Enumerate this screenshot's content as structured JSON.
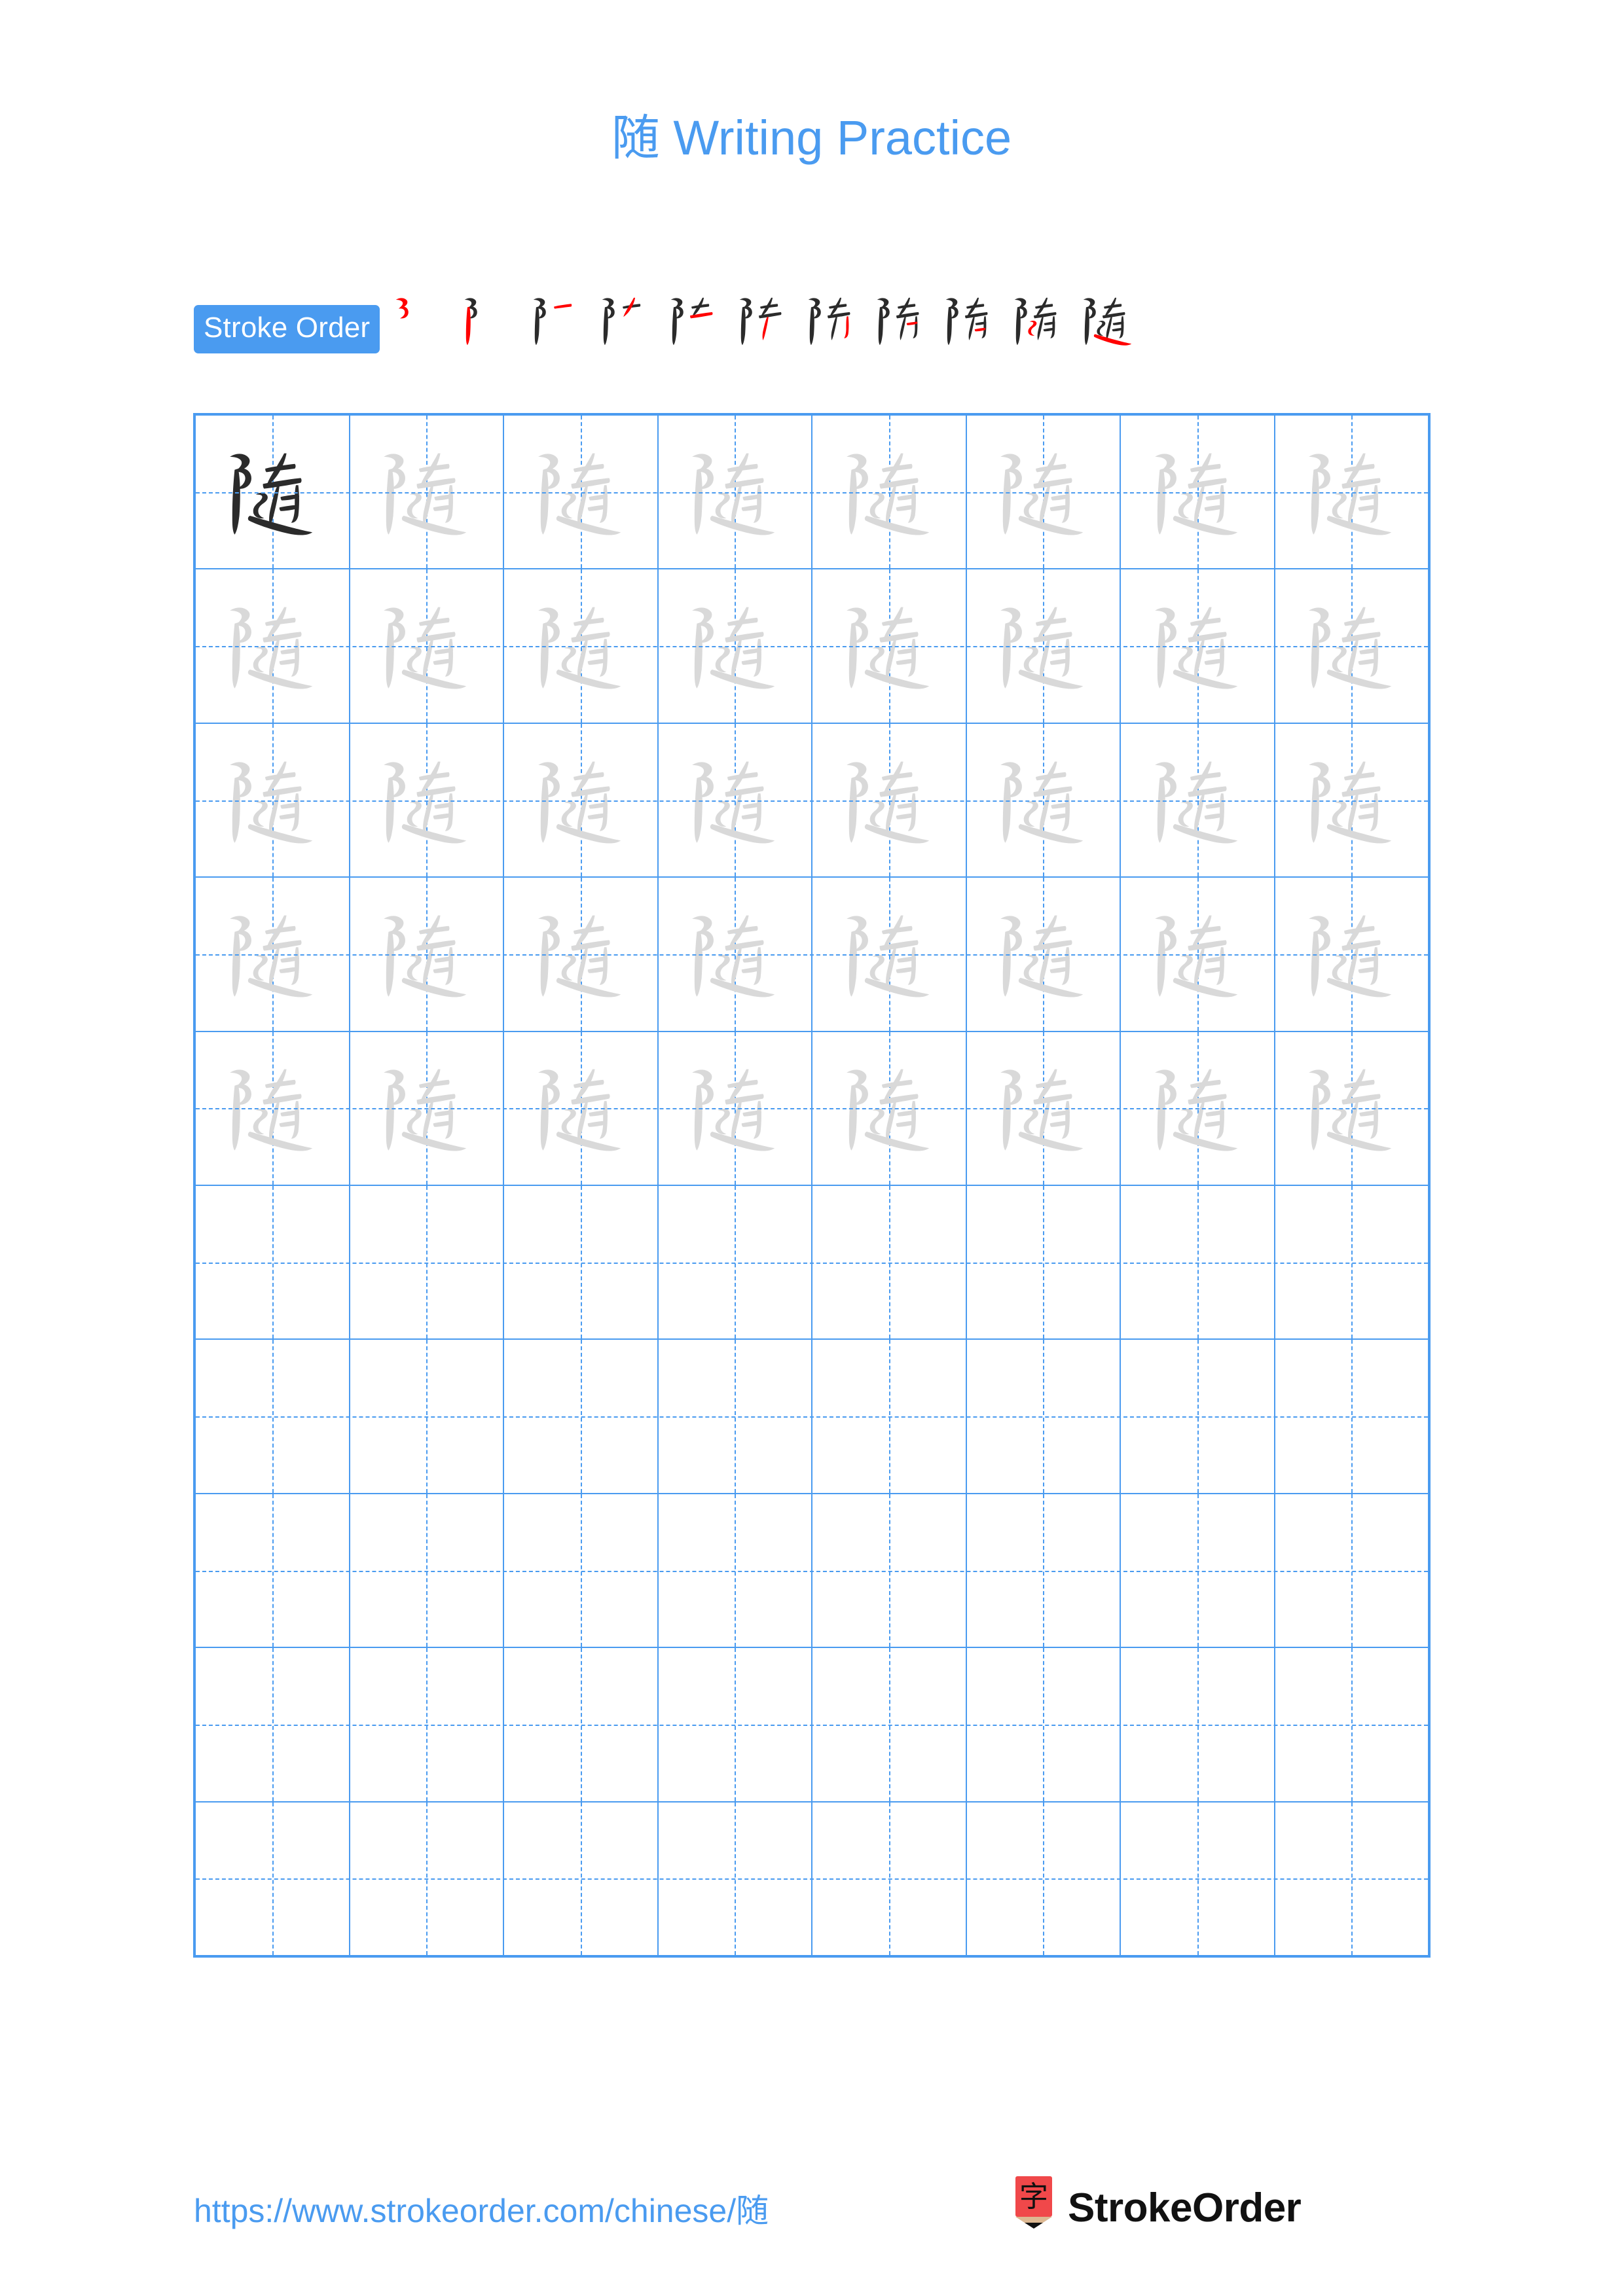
{
  "page": {
    "title_character": "随",
    "title_text": "随 Writing Practice",
    "accent_color": "#4a9bf0",
    "ink_color": "#2b2b2b",
    "trace_color": "#d9d9d9",
    "highlight_stroke_color": "#ff0000"
  },
  "stroke_order": {
    "label": "Stroke Order",
    "character": "随",
    "total_strokes": 11,
    "steps": [
      {
        "index": 1,
        "strokes_shown": 1
      },
      {
        "index": 2,
        "strokes_shown": 2
      },
      {
        "index": 3,
        "strokes_shown": 3
      },
      {
        "index": 4,
        "strokes_shown": 4
      },
      {
        "index": 5,
        "strokes_shown": 5
      },
      {
        "index": 6,
        "strokes_shown": 6
      },
      {
        "index": 7,
        "strokes_shown": 7
      },
      {
        "index": 8,
        "strokes_shown": 8
      },
      {
        "index": 9,
        "strokes_shown": 9
      },
      {
        "index": 10,
        "strokes_shown": 10
      },
      {
        "index": 11,
        "strokes_shown": 11
      }
    ]
  },
  "practice_grid": {
    "columns": 8,
    "rows": 10,
    "rows_data": [
      {
        "cells": [
          "dark",
          "light",
          "light",
          "light",
          "light",
          "light",
          "light",
          "light"
        ]
      },
      {
        "cells": [
          "light",
          "light",
          "light",
          "light",
          "light",
          "light",
          "light",
          "light"
        ]
      },
      {
        "cells": [
          "light",
          "light",
          "light",
          "light",
          "light",
          "light",
          "light",
          "light"
        ]
      },
      {
        "cells": [
          "light",
          "light",
          "light",
          "light",
          "light",
          "light",
          "light",
          "light"
        ]
      },
      {
        "cells": [
          "light",
          "light",
          "light",
          "light",
          "light",
          "light",
          "light",
          "light"
        ]
      },
      {
        "cells": [
          "empty",
          "empty",
          "empty",
          "empty",
          "empty",
          "empty",
          "empty",
          "empty"
        ]
      },
      {
        "cells": [
          "empty",
          "empty",
          "empty",
          "empty",
          "empty",
          "empty",
          "empty",
          "empty"
        ]
      },
      {
        "cells": [
          "empty",
          "empty",
          "empty",
          "empty",
          "empty",
          "empty",
          "empty",
          "empty"
        ]
      },
      {
        "cells": [
          "empty",
          "empty",
          "empty",
          "empty",
          "empty",
          "empty",
          "empty",
          "empty"
        ]
      },
      {
        "cells": [
          "empty",
          "empty",
          "empty",
          "empty",
          "empty",
          "empty",
          "empty",
          "empty"
        ]
      }
    ]
  },
  "footer": {
    "url": "https://www.strokeorder.com/chinese/随",
    "brand_name": "StrokeOrder",
    "brand_logo_character": "字",
    "brand_logo_color": "#f0484a",
    "brand_logo_wood_color": "#ddb892"
  }
}
